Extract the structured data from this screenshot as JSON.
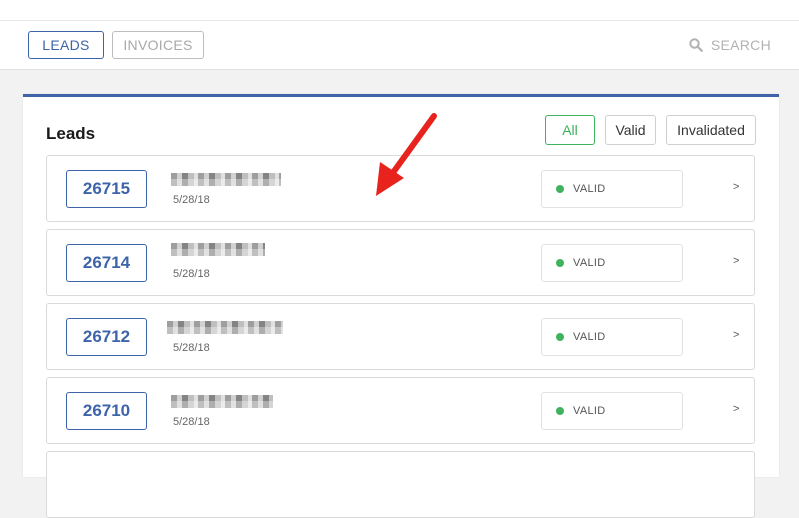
{
  "nav": {
    "tabs": [
      {
        "label": "LEADS",
        "active": true
      },
      {
        "label": "INVOICES",
        "active": false
      }
    ],
    "search_label": "SEARCH",
    "search_icon": "search-icon"
  },
  "panel": {
    "title": "Leads",
    "filters": [
      {
        "label": "All",
        "active": true
      },
      {
        "label": "Valid",
        "active": false
      },
      {
        "label": "Invalidated",
        "active": false
      }
    ]
  },
  "leads": [
    {
      "id": "26715",
      "date": "5/28/18",
      "status": "VALID",
      "chevron": ">"
    },
    {
      "id": "26714",
      "date": "5/28/18",
      "status": "VALID",
      "chevron": ">"
    },
    {
      "id": "26712",
      "date": "5/28/18",
      "status": "VALID",
      "chevron": ">"
    },
    {
      "id": "26710",
      "date": "5/28/18",
      "status": "VALID",
      "chevron": ">"
    }
  ],
  "colors": {
    "accent": "#3d64a8",
    "valid": "#3eb25c",
    "annotation_arrow": "#e8231d"
  }
}
